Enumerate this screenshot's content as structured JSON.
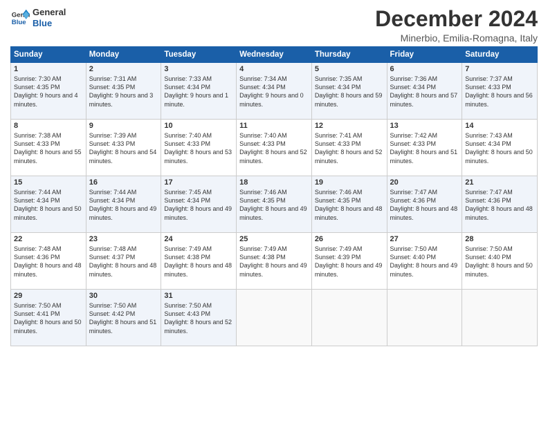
{
  "header": {
    "logo_line1": "General",
    "logo_line2": "Blue",
    "month": "December 2024",
    "location": "Minerbio, Emilia-Romagna, Italy"
  },
  "days_of_week": [
    "Sunday",
    "Monday",
    "Tuesday",
    "Wednesday",
    "Thursday",
    "Friday",
    "Saturday"
  ],
  "weeks": [
    [
      {
        "day": "1",
        "rise": "7:30 AM",
        "set": "4:35 PM",
        "daylight": "9 hours and 4 minutes."
      },
      {
        "day": "2",
        "rise": "7:31 AM",
        "set": "4:35 PM",
        "daylight": "9 hours and 3 minutes."
      },
      {
        "day": "3",
        "rise": "7:33 AM",
        "set": "4:34 PM",
        "daylight": "9 hours and 1 minute."
      },
      {
        "day": "4",
        "rise": "7:34 AM",
        "set": "4:34 PM",
        "daylight": "9 hours and 0 minutes."
      },
      {
        "day": "5",
        "rise": "7:35 AM",
        "set": "4:34 PM",
        "daylight": "8 hours and 59 minutes."
      },
      {
        "day": "6",
        "rise": "7:36 AM",
        "set": "4:34 PM",
        "daylight": "8 hours and 57 minutes."
      },
      {
        "day": "7",
        "rise": "7:37 AM",
        "set": "4:33 PM",
        "daylight": "8 hours and 56 minutes."
      }
    ],
    [
      {
        "day": "8",
        "rise": "7:38 AM",
        "set": "4:33 PM",
        "daylight": "8 hours and 55 minutes."
      },
      {
        "day": "9",
        "rise": "7:39 AM",
        "set": "4:33 PM",
        "daylight": "8 hours and 54 minutes."
      },
      {
        "day": "10",
        "rise": "7:40 AM",
        "set": "4:33 PM",
        "daylight": "8 hours and 53 minutes."
      },
      {
        "day": "11",
        "rise": "7:40 AM",
        "set": "4:33 PM",
        "daylight": "8 hours and 52 minutes."
      },
      {
        "day": "12",
        "rise": "7:41 AM",
        "set": "4:33 PM",
        "daylight": "8 hours and 52 minutes."
      },
      {
        "day": "13",
        "rise": "7:42 AM",
        "set": "4:33 PM",
        "daylight": "8 hours and 51 minutes."
      },
      {
        "day": "14",
        "rise": "7:43 AM",
        "set": "4:34 PM",
        "daylight": "8 hours and 50 minutes."
      }
    ],
    [
      {
        "day": "15",
        "rise": "7:44 AM",
        "set": "4:34 PM",
        "daylight": "8 hours and 50 minutes."
      },
      {
        "day": "16",
        "rise": "7:44 AM",
        "set": "4:34 PM",
        "daylight": "8 hours and 49 minutes."
      },
      {
        "day": "17",
        "rise": "7:45 AM",
        "set": "4:34 PM",
        "daylight": "8 hours and 49 minutes."
      },
      {
        "day": "18",
        "rise": "7:46 AM",
        "set": "4:35 PM",
        "daylight": "8 hours and 49 minutes."
      },
      {
        "day": "19",
        "rise": "7:46 AM",
        "set": "4:35 PM",
        "daylight": "8 hours and 48 minutes."
      },
      {
        "day": "20",
        "rise": "7:47 AM",
        "set": "4:36 PM",
        "daylight": "8 hours and 48 minutes."
      },
      {
        "day": "21",
        "rise": "7:47 AM",
        "set": "4:36 PM",
        "daylight": "8 hours and 48 minutes."
      }
    ],
    [
      {
        "day": "22",
        "rise": "7:48 AM",
        "set": "4:36 PM",
        "daylight": "8 hours and 48 minutes."
      },
      {
        "day": "23",
        "rise": "7:48 AM",
        "set": "4:37 PM",
        "daylight": "8 hours and 48 minutes."
      },
      {
        "day": "24",
        "rise": "7:49 AM",
        "set": "4:38 PM",
        "daylight": "8 hours and 48 minutes."
      },
      {
        "day": "25",
        "rise": "7:49 AM",
        "set": "4:38 PM",
        "daylight": "8 hours and 49 minutes."
      },
      {
        "day": "26",
        "rise": "7:49 AM",
        "set": "4:39 PM",
        "daylight": "8 hours and 49 minutes."
      },
      {
        "day": "27",
        "rise": "7:50 AM",
        "set": "4:40 PM",
        "daylight": "8 hours and 49 minutes."
      },
      {
        "day": "28",
        "rise": "7:50 AM",
        "set": "4:40 PM",
        "daylight": "8 hours and 50 minutes."
      }
    ],
    [
      {
        "day": "29",
        "rise": "7:50 AM",
        "set": "4:41 PM",
        "daylight": "8 hours and 50 minutes."
      },
      {
        "day": "30",
        "rise": "7:50 AM",
        "set": "4:42 PM",
        "daylight": "8 hours and 51 minutes."
      },
      {
        "day": "31",
        "rise": "7:50 AM",
        "set": "4:43 PM",
        "daylight": "8 hours and 52 minutes."
      },
      null,
      null,
      null,
      null
    ]
  ]
}
